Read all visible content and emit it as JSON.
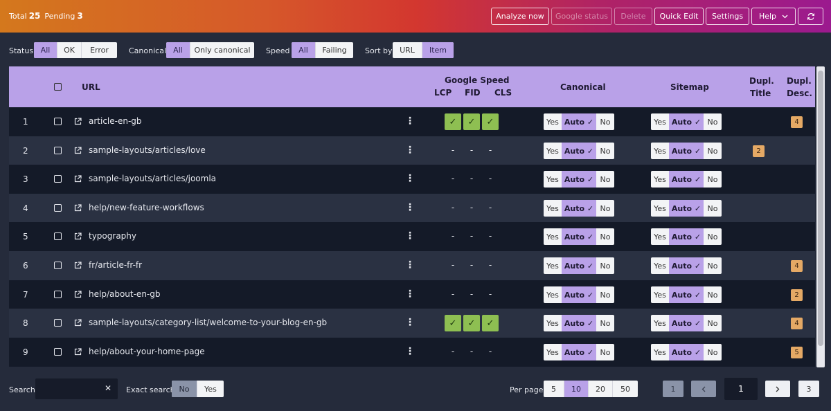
{
  "header": {
    "total_label": "Total",
    "total_value": "25",
    "pending_label": "Pending",
    "pending_value": "3",
    "buttons": {
      "analyze": "Analyze now",
      "google_status": "Google status",
      "delete": "Delete",
      "quick_edit": "Quick Edit",
      "settings": "Settings",
      "help": "Help"
    }
  },
  "filters": {
    "status": {
      "label": "Status",
      "options": [
        "All",
        "OK",
        "Error"
      ],
      "selected": "All"
    },
    "canonical": {
      "label": "Canonical",
      "options": [
        "All",
        "Only canonical"
      ],
      "selected": "All"
    },
    "speed": {
      "label": "Speed",
      "options": [
        "All",
        "Failing"
      ],
      "selected": "All"
    },
    "sort": {
      "label": "Sort by",
      "options": [
        "URL",
        "Item"
      ],
      "selected": "Item"
    }
  },
  "table": {
    "columns": {
      "url": "URL",
      "google_speed": "Google Speed",
      "lcp": "LCP",
      "fid": "FID",
      "cls": "CLS",
      "canonical": "Canonical",
      "sitemap": "Sitemap",
      "dupl_title_1": "Dupl.",
      "dupl_title_2": "Title",
      "dupl_desc_1": "Dupl.",
      "dupl_desc_2": "Desc."
    },
    "toggle": {
      "yes": "Yes",
      "auto": "Auto ✓",
      "no": "No"
    },
    "dash": "-",
    "rows": [
      {
        "num": "1",
        "url": "article-en-gb",
        "speed_ok": true,
        "dupl_title": "",
        "dupl_desc": "4"
      },
      {
        "num": "2",
        "url": "sample-layouts/articles/love",
        "speed_ok": false,
        "dupl_title": "2",
        "dupl_desc": ""
      },
      {
        "num": "3",
        "url": "sample-layouts/articles/joomla",
        "speed_ok": false,
        "dupl_title": "",
        "dupl_desc": ""
      },
      {
        "num": "4",
        "url": "help/new-feature-workflows",
        "speed_ok": false,
        "dupl_title": "",
        "dupl_desc": ""
      },
      {
        "num": "5",
        "url": "typography",
        "speed_ok": false,
        "dupl_title": "",
        "dupl_desc": ""
      },
      {
        "num": "6",
        "url": "fr/article-fr-fr",
        "speed_ok": false,
        "dupl_title": "",
        "dupl_desc": "4"
      },
      {
        "num": "7",
        "url": "help/about-en-gb",
        "speed_ok": false,
        "dupl_title": "",
        "dupl_desc": "2"
      },
      {
        "num": "8",
        "url": "sample-layouts/category-list/welcome-to-your-blog-en-gb",
        "speed_ok": true,
        "dupl_title": "",
        "dupl_desc": "4"
      },
      {
        "num": "9",
        "url": "help/about-your-home-page",
        "speed_ok": false,
        "dupl_title": "",
        "dupl_desc": "5"
      }
    ]
  },
  "footer": {
    "search_label": "Search",
    "search_value": "",
    "exact_label": "Exact search",
    "exact_options": [
      "No",
      "Yes"
    ],
    "exact_selected": "No",
    "per_page_label": "Per page",
    "per_page_options": [
      "5",
      "10",
      "20",
      "50"
    ],
    "per_page_selected": "10",
    "first_page": "1",
    "current_page": "1",
    "last_page": "3"
  },
  "colors": {
    "accent": "#b9a1e8",
    "speed_ok": "#8ebf52",
    "badge": "#e5a965"
  }
}
